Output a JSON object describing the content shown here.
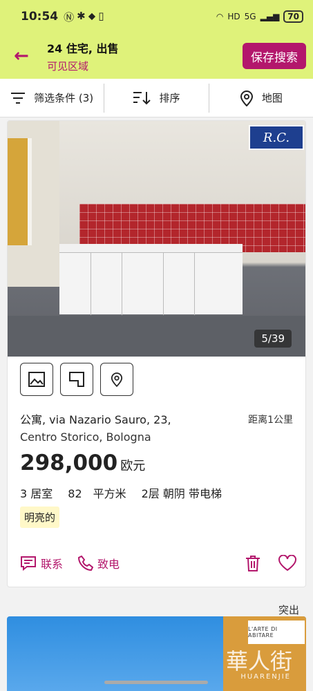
{
  "status_bar": {
    "time": "10:54",
    "network_label": "HD",
    "network_type": "5G",
    "battery": "70"
  },
  "header": {
    "title": "24 住宅, 出售",
    "subtitle": "可见区域",
    "save_label": "保存搜索"
  },
  "toolbar": {
    "filter_label": "筛选条件 (3)",
    "sort_label": "排序",
    "map_label": "地图"
  },
  "listing": {
    "photo_counter": "5/39",
    "agency_logo_text": "R.C.",
    "address_line1": "公寓, via Nazario Sauro, 23,",
    "address_line2": "Centro Storico, Bologna",
    "distance": "距离1公里",
    "price": "298,000",
    "currency": "欧元",
    "features": [
      "3 居室",
      "82　平方米",
      "2层 朝阴 带电梯"
    ],
    "tag": "明亮的",
    "contact_label": "联系",
    "call_label": "致电"
  },
  "next_listing": {
    "badge": "突出",
    "agency_logo_text": "L'ARTE DI ABITARE",
    "watermark": "華人街",
    "watermark_sub": "HUARENJIE"
  },
  "colors": {
    "accent": "#b3176c",
    "header_bg": "#dff27a"
  }
}
